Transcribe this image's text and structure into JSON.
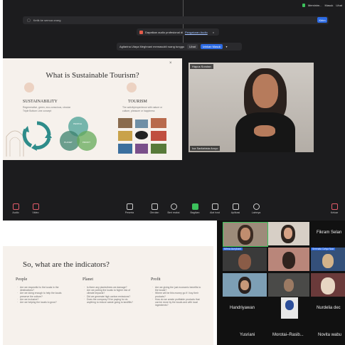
{
  "top": {
    "status": {
      "minimize_label": "Meminim...",
      "enter_label": "Masuk",
      "view_label": "Lihat"
    },
    "chat_input": {
      "placeholder": "Ketik ke semua orang",
      "send_label": "Kirim"
    },
    "notice1": {
      "text": "Dapatkan audio profesional di",
      "link": "Pengaturan Audio"
    },
    "notice2": {
      "text": "Agitarina Utaya Meghnani memasukti ruang tunggu",
      "view_label": "Lihat",
      "admit_label": "Izinkan Masuk"
    },
    "slide": {
      "title": "What is Sustainable Tourism?",
      "left_heading": "SUSTAINABILITY",
      "left_sub1": "Regenerative, green, eco-conscious, circular",
      "left_sub2": "Triple Bottom Line concept",
      "right_heading": "TOURISM",
      "right_sub1": "The activity/experience with nature or",
      "right_sub2": "culture, pleasure or happiness",
      "venn": [
        "PEOPLE",
        "PLANET",
        "PROFIT"
      ]
    },
    "speaker": {
      "tag": "Hapus Sorotan",
      "name": "Ica Sarilahista Aroyo"
    },
    "toolbar": [
      {
        "label": "Audio",
        "icon": "mic-icon"
      },
      {
        "label": "Video",
        "icon": "video-icon"
      },
      {
        "label": "Peserta",
        "icon": "participants-icon"
      },
      {
        "label": "Obrolan",
        "icon": "chat-icon"
      },
      {
        "label": "Beri reaksi",
        "icon": "reaction-icon"
      },
      {
        "label": "Bagikan",
        "icon": "share-icon"
      },
      {
        "label": "Alat host",
        "icon": "shield-icon"
      },
      {
        "label": "Aplikasi",
        "icon": "apps-icon"
      },
      {
        "label": "Lainnya",
        "icon": "more-icon"
      }
    ],
    "end_label": "Keluar"
  },
  "bottom": {
    "slide": {
      "title": "So, what are the indicators?",
      "columns": [
        {
          "heading": "People",
          "items": [
            "Are we respectful to the locals in the destinations?",
            "Are we doing enough to help the locals preserve the culture?",
            "Are we inclusive?",
            "Are we helping the locals to grow?"
          ]
        },
        {
          "heading": "Planet",
          "items": [
            "Is there any plants/trees we damage?",
            "Are we putting the locals to higher risk of climate impacts?",
            "Did we generate high carbon emissions?",
            "Does the company I'll be paying for do anything to reduce waste going to landfills?"
          ]
        },
        {
          "heading": "Profit",
          "items": [
            "Are we giving the just economic benefits to the locals?",
            "Where will be this money go if I buy their products?",
            "How do we create profitable products that can be done by the locals and with local ingredients?"
          ]
        }
      ]
    },
    "gallery": {
      "top_right_name": "Fikram Selan",
      "labels": [
        "Mirna Auryhani",
        "Serenata Cahya Naw"
      ],
      "names": [
        "Handriyawan",
        "Nurdelia dec",
        "Yusriani",
        "Morotai–Rasib...",
        "Novita wabu"
      ]
    }
  },
  "colors": {
    "accent": "#2d6be4",
    "teal": "#2e8c8a",
    "green": "#5aa35a",
    "bg_dark": "#1c1c1e"
  }
}
